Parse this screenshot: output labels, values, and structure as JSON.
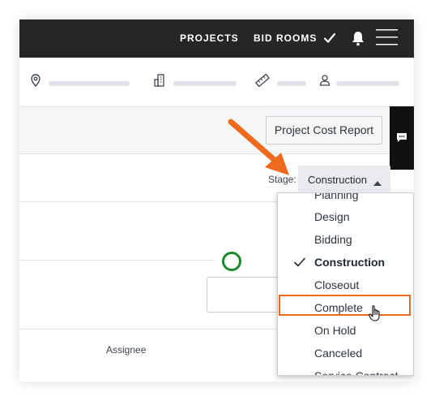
{
  "topbar": {
    "projects_label": "PROJECTS",
    "bid_rooms_label": "BID ROOMS"
  },
  "icons": {
    "checkmark": "check-icon",
    "notifications": "bell-icon",
    "menu": "hamburger-menu-icon",
    "location": "map-pin-icon",
    "building": "building-icon",
    "measure": "ruler-icon",
    "user": "user-icon",
    "chat": "chat-icon"
  },
  "header": {
    "report_button_label": "Project Cost Report"
  },
  "stage": {
    "label": "Stage:",
    "selected": "Construction"
  },
  "dropdown": {
    "options": [
      "Planning",
      "Design",
      "Bidding",
      "Construction",
      "Closeout",
      "Complete",
      "On Hold",
      "Canceled",
      "Service Contract"
    ],
    "checked": "Construction",
    "hovered": "Complete"
  },
  "table": {
    "assignee_header": "Assignee"
  },
  "colors": {
    "topbar_bg": "#262626",
    "annotation_orange": "#f06a1d",
    "status_green": "#1a8a2c"
  }
}
